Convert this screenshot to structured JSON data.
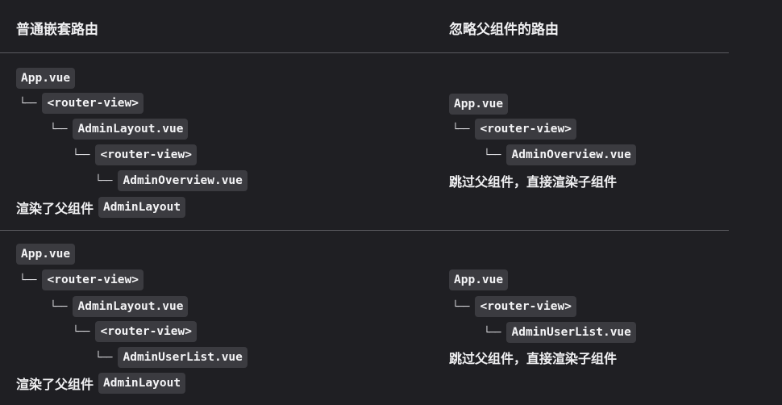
{
  "headers": {
    "left": "普通嵌套路由",
    "right": "忽略父组件的路由"
  },
  "branch_glyph": "└──",
  "rows": [
    {
      "left": {
        "tree": [
          "App.vue",
          "<router-view>",
          "AdminLayout.vue",
          "<router-view>",
          "AdminOverview.vue"
        ],
        "note_text": "渲染了父组件",
        "note_code": "AdminLayout"
      },
      "right": {
        "tree": [
          "App.vue",
          "<router-view>",
          "AdminOverview.vue"
        ],
        "note_text": "跳过父组件，直接渲染子组件"
      }
    },
    {
      "left": {
        "tree": [
          "App.vue",
          "<router-view>",
          "AdminLayout.vue",
          "<router-view>",
          "AdminUserList.vue"
        ],
        "note_text": "渲染了父组件",
        "note_code": "AdminLayout"
      },
      "right": {
        "tree": [
          "App.vue",
          "<router-view>",
          "AdminUserList.vue"
        ],
        "note_text": "跳过父组件，直接渲染子组件"
      }
    }
  ]
}
